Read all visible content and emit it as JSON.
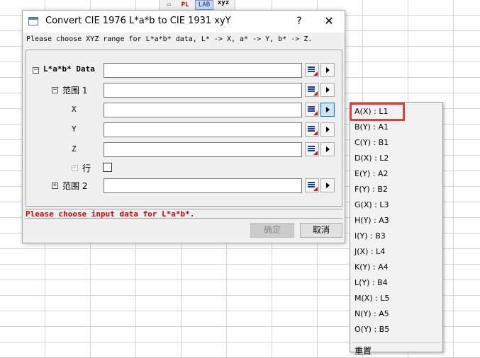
{
  "toolbar_buttons": [
    "PL",
    "LAB",
    "xyz"
  ],
  "dialog": {
    "title": "Convert CIE 1976 L*a*b to CIE 1931 xyY",
    "help": "?",
    "close": "✕",
    "instruction": "Please choose XYZ range for L*a*b* data, L* -> X, a* -> Y, b* -> Z.",
    "tree": {
      "root_toggle": "−",
      "root_label": "L*a*b* Data",
      "range1_toggle": "−",
      "range1_label": "范围 1",
      "x_label": "X",
      "y_label": "Y",
      "z_label": "Z",
      "row_toggle": "+",
      "row_label": "行",
      "range2_toggle": "+",
      "range2_label": "范围 2"
    },
    "status": "Please choose input data for L*a*b*.",
    "ok": "确定",
    "cancel": "取消"
  },
  "popup_menu": {
    "items": [
      "A(X) : L1",
      "B(Y) : A1",
      "C(Y) : B1",
      "D(X) : L2",
      "E(Y) : A2",
      "F(Y) : B2",
      "G(X) : L3",
      "H(Y) : A3",
      "I(Y) : B3",
      "J(X) : L4",
      "K(Y) : A4",
      "L(Y) : B4",
      "M(X) : L5",
      "N(Y) : A5",
      "O(Y) : B5"
    ],
    "highlighted_index": 0,
    "bottom_item": "重置"
  },
  "colors": {
    "highlight": "#e33e3e",
    "status_red": "#d40000",
    "active_button": "#cce4f7"
  }
}
